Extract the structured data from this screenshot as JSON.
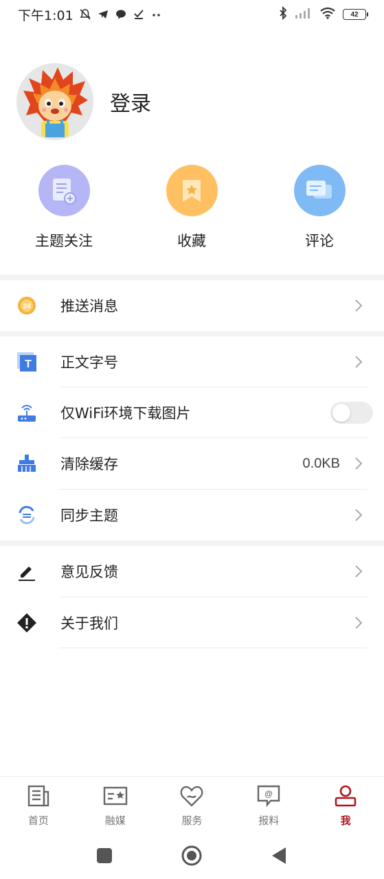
{
  "status_bar": {
    "time": "下午1:01",
    "battery": "42"
  },
  "profile": {
    "login_label": "登录"
  },
  "quick_actions": [
    {
      "label": "主题关注",
      "icon": "topic-follow-icon",
      "color": "#b4b6f5"
    },
    {
      "label": "收藏",
      "icon": "bookmark-icon",
      "color": "#ffc061"
    },
    {
      "label": "评论",
      "icon": "comment-icon",
      "color": "#7fbaf5"
    }
  ],
  "settings": {
    "push": {
      "label": "推送消息"
    },
    "font_size": {
      "label": "正文字号"
    },
    "wifi_images": {
      "label": "仅WiFi环境下载图片",
      "enabled": false
    },
    "clear_cache": {
      "label": "清除缓存",
      "value": "0.0KB"
    },
    "sync_topics": {
      "label": "同步主题"
    },
    "feedback": {
      "label": "意见反馈"
    },
    "about": {
      "label": "关于我们"
    }
  },
  "bottom_nav": [
    {
      "label": "首页",
      "icon": "newspaper-icon",
      "active": false
    },
    {
      "label": "融媒",
      "icon": "media-card-icon",
      "active": false
    },
    {
      "label": "服务",
      "icon": "heart-service-icon",
      "active": false
    },
    {
      "label": "报料",
      "icon": "report-chat-icon",
      "active": false
    },
    {
      "label": "我",
      "icon": "person-icon",
      "active": true
    }
  ],
  "colors": {
    "accent": "#b0151d",
    "push_badge": "#f5b13a",
    "icon_blue": "#3f7be0"
  }
}
